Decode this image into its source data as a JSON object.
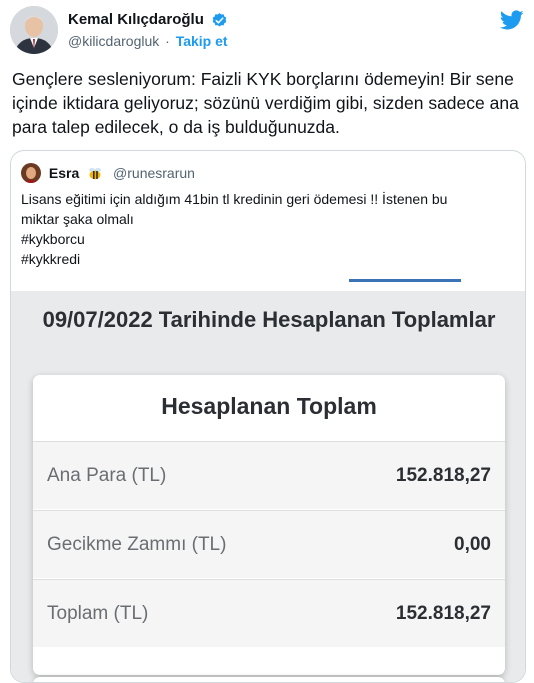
{
  "author": {
    "display_name": "Kemal Kılıçdaroğlu",
    "handle": "@kilicdarogluk",
    "separator": "·",
    "follow_label": "Takip et",
    "verified_icon": "verified-badge-icon"
  },
  "brand": {
    "icon": "twitter-bird-icon",
    "color": "#1d9bf0"
  },
  "tweet": {
    "text": "Gençlere sesleniyorum: Faizli KYK borçlarını ödemeyin! Bir sene içinde iktidara geliyoruz; sözünü verdiğim gibi, sizden sadece ana para talep edilecek, o da iş bulduğunuzda."
  },
  "quote": {
    "display_name": "Esra",
    "emoji": "🐝",
    "handle": "@runesrarun",
    "lines": [
      "Lisans eğitimi için aldığım 41bin tl kredinin geri ödemesi !! İstenen bu",
      "miktar şaka olmalı",
      "#kykborcu",
      "#kykkredi"
    ]
  },
  "media": {
    "title": "09/07/2022 Tarihinde Hesaplanan Toplamlar",
    "card_title": "Hesaplanan Toplam",
    "rows": [
      {
        "label": "Ana Para (TL)",
        "value": "152.818,27"
      },
      {
        "label": "Gecikme Zammı (TL)",
        "value": "0,00"
      },
      {
        "label": "Toplam (TL)",
        "value": "152.818,27"
      }
    ]
  }
}
